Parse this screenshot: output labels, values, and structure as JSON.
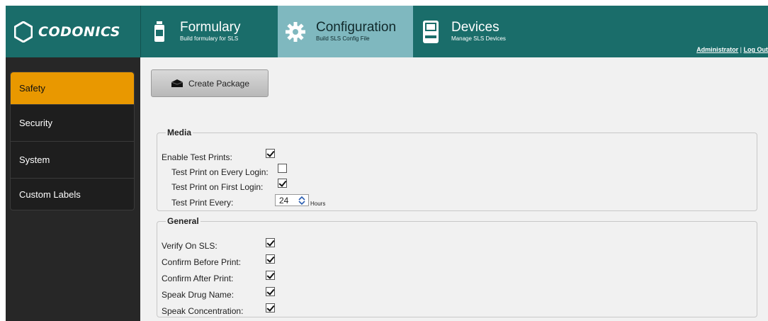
{
  "brand": {
    "name": "CODONICS"
  },
  "nav": {
    "tabs": [
      {
        "title": "Formulary",
        "subtitle": "Build formulary for SLS",
        "icon": "bottle-icon"
      },
      {
        "title": "Configuration",
        "subtitle": "Build SLS Config File",
        "icon": "gear-icon",
        "active": true
      },
      {
        "title": "Devices",
        "subtitle": "Manage SLS Devices",
        "icon": "device-icon"
      }
    ],
    "user": "Administrator",
    "separator": "|",
    "logout": "Log Out"
  },
  "sidebar": {
    "items": [
      {
        "label": "Safety",
        "active": true
      },
      {
        "label": "Security"
      },
      {
        "label": "System"
      },
      {
        "label": "Custom Labels"
      }
    ]
  },
  "toolbar": {
    "create_label": "Create Package",
    "create_icon": "package-icon"
  },
  "media": {
    "legend": "Media",
    "enable_test_prints": {
      "label": "Enable Test Prints:",
      "checked": true
    },
    "every_login": {
      "label": "Test Print on Every Login:",
      "checked": false
    },
    "first_login": {
      "label": "Test Print on First Login:",
      "checked": true
    },
    "print_every": {
      "label": "Test Print Every:",
      "value": "24",
      "unit": "Hours"
    }
  },
  "general": {
    "legend": "General",
    "items": [
      {
        "label": "Verify On SLS:",
        "checked": true
      },
      {
        "label": "Confirm Before Print:",
        "checked": true
      },
      {
        "label": "Confirm After Print:",
        "checked": true
      },
      {
        "label": "Speak Drug Name:",
        "checked": true
      },
      {
        "label": "Speak Concentration:",
        "checked": true
      }
    ]
  },
  "colors": {
    "topbar": "#1a6d6a",
    "active_tab": "#7fb8bf",
    "sidebar_active": "#e99800"
  }
}
